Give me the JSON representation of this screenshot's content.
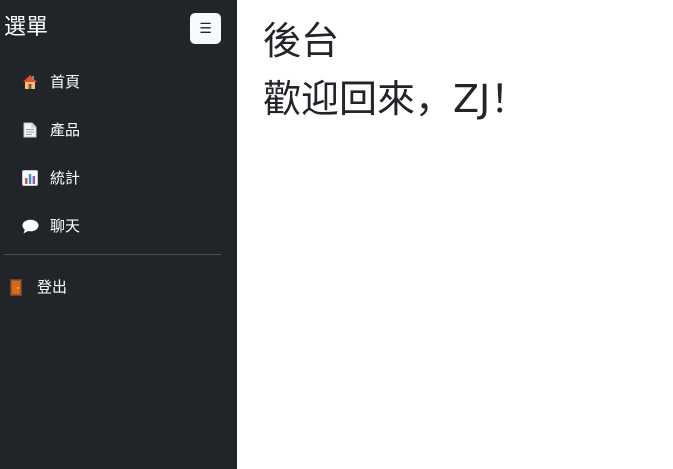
{
  "sidebar": {
    "title": "選單",
    "toggle_label": "☰",
    "items": [
      {
        "label": "首頁",
        "icon": "house-icon"
      },
      {
        "label": "產品",
        "icon": "document-icon"
      },
      {
        "label": "統計",
        "icon": "bar-chart-icon"
      },
      {
        "label": "聊天",
        "icon": "speech-bubble-icon"
      }
    ],
    "logout": {
      "label": "登出",
      "icon": "door-icon"
    }
  },
  "main": {
    "title": "後台",
    "welcome": "歡迎回來，ZJ！"
  },
  "colors": {
    "sidebar_bg": "#212529",
    "main_bg": "#ffffff",
    "text_dark": "#212529"
  }
}
